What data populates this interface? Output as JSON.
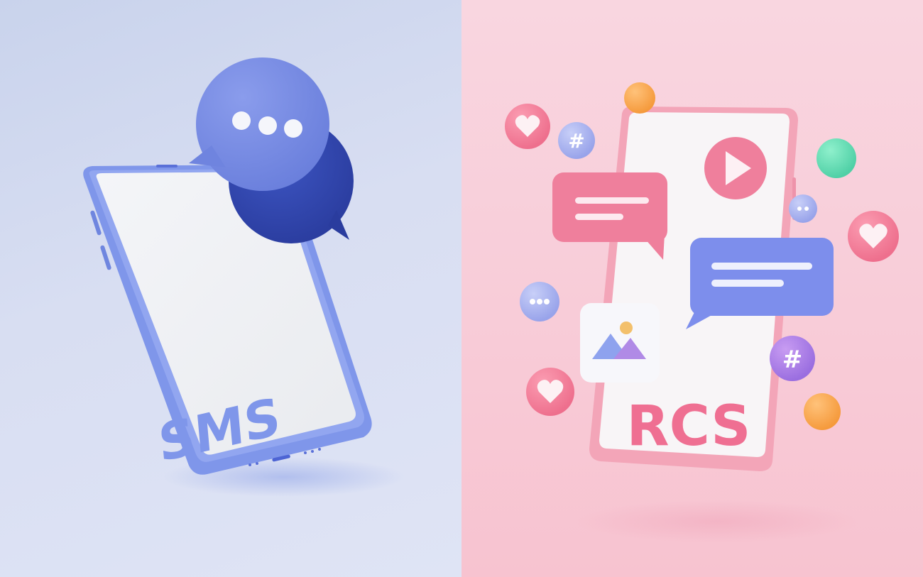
{
  "left_panel": {
    "phone_label": "SMS",
    "colors": {
      "background": "#d8def2",
      "phone_frame": "#7f96ea",
      "bubble_front": "#7b8fe4",
      "bubble_back": "#3147b0",
      "label": "#7f96ea"
    },
    "icons": [
      "phone-icon",
      "chat-bubble-icon",
      "typing-dots-icon"
    ]
  },
  "right_panel": {
    "phone_label": "RCS",
    "hash_symbol": "#",
    "colors": {
      "background": "#f8cbd7",
      "phone_frame": "#f3a5b8",
      "pink_bubble": "#ef7f9c",
      "blue_bubble": "#7d8eec",
      "label": "#ef6f92"
    },
    "icons": [
      "phone-icon",
      "play-button-icon",
      "image-icon",
      "heart-icon",
      "hashtag-icon",
      "chat-bubble-icon",
      "typing-dots-icon"
    ]
  }
}
